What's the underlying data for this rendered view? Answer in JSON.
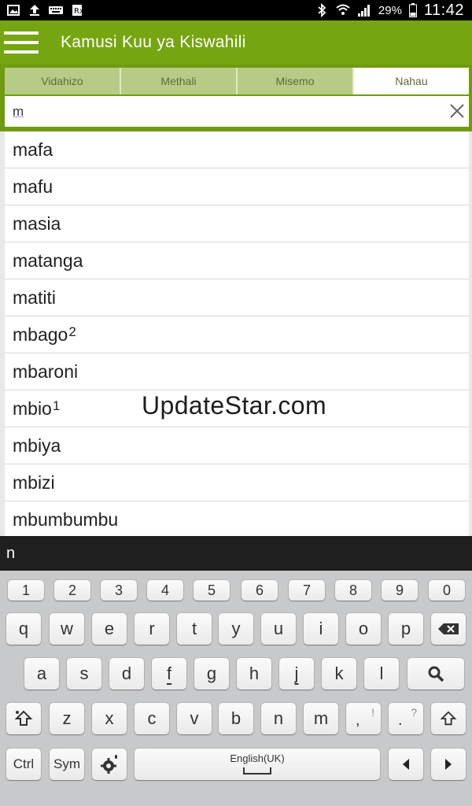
{
  "status": {
    "battery": "29%",
    "time": "11:42"
  },
  "app": {
    "title": "Kamusi Kuu ya Kiswahili"
  },
  "tabs": [
    "Vidahizo",
    "Methali",
    "Misemo",
    "Nahau"
  ],
  "active_tab": "Nahau",
  "search": {
    "value": "m"
  },
  "results": [
    {
      "word": "mafa",
      "sup": ""
    },
    {
      "word": "mafu",
      "sup": ""
    },
    {
      "word": "masia",
      "sup": ""
    },
    {
      "word": "matanga",
      "sup": ""
    },
    {
      "word": "matiti",
      "sup": ""
    },
    {
      "word": "mbago",
      "sup": "2"
    },
    {
      "word": "mbaroni",
      "sup": ""
    },
    {
      "word": "mbio",
      "sup": "1"
    },
    {
      "word": "mbiya",
      "sup": ""
    },
    {
      "word": "mbizi",
      "sup": ""
    },
    {
      "word": "mbumbumbu",
      "sup": ""
    }
  ],
  "watermark": "UpdateStar.com",
  "suggestion": "n",
  "keyboard": {
    "numbers": [
      "1",
      "2",
      "3",
      "4",
      "5",
      "6",
      "7",
      "8",
      "9",
      "0"
    ],
    "row1": [
      "q",
      "w",
      "e",
      "r",
      "t",
      "y",
      "u",
      "i",
      "o",
      "p"
    ],
    "row2": [
      "a",
      "s",
      "d",
      "f",
      "g",
      "h",
      "j",
      "k",
      "l"
    ],
    "row3": [
      "z",
      "x",
      "c",
      "v",
      "b",
      "n",
      "m"
    ],
    "comma": ",",
    "comma_alt": "!",
    "period": ".",
    "period_alt": "?",
    "ctrl": "Ctrl",
    "sym": "Sym",
    "space_label": "English(UK)"
  },
  "colors": {
    "appbar": "#76a512",
    "tab_inactive": "#b6cc86",
    "tab_active": "#ffffff"
  }
}
